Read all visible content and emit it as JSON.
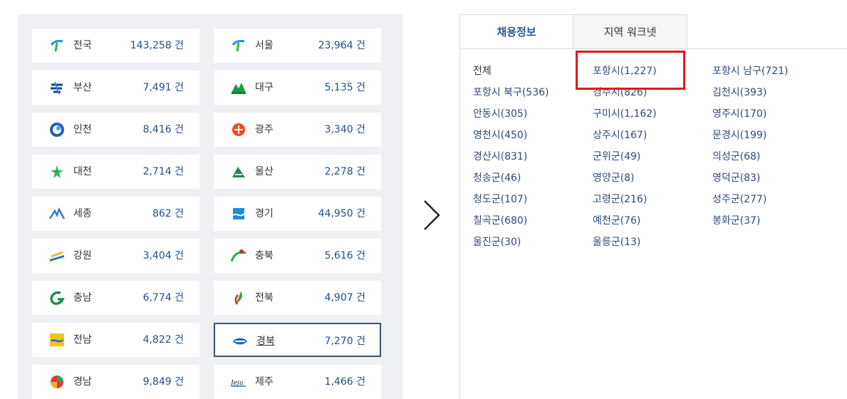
{
  "regions": [
    {
      "name": "전국",
      "count": "143,258 건",
      "icon": "nationwide-logo"
    },
    {
      "name": "서울",
      "count": "23,964 건",
      "icon": "seoul-logo"
    },
    {
      "name": "부산",
      "count": "7,491 건",
      "icon": "busan-logo"
    },
    {
      "name": "대구",
      "count": "5,135 건",
      "icon": "daegu-logo"
    },
    {
      "name": "인천",
      "count": "8,416 건",
      "icon": "incheon-logo"
    },
    {
      "name": "광주",
      "count": "3,340 건",
      "icon": "gwangju-logo"
    },
    {
      "name": "대전",
      "count": "2,714 건",
      "icon": "daejeon-logo"
    },
    {
      "name": "울산",
      "count": "2,278 건",
      "icon": "ulsan-logo"
    },
    {
      "name": "세종",
      "count": "862 건",
      "icon": "sejong-logo"
    },
    {
      "name": "경기",
      "count": "44,950 건",
      "icon": "gyeonggi-logo"
    },
    {
      "name": "강원",
      "count": "3,404 건",
      "icon": "gangwon-logo"
    },
    {
      "name": "충북",
      "count": "5,616 건",
      "icon": "chungbuk-logo"
    },
    {
      "name": "충남",
      "count": "6,774 건",
      "icon": "chungnam-logo"
    },
    {
      "name": "전북",
      "count": "4,907 건",
      "icon": "jeonbuk-logo"
    },
    {
      "name": "전남",
      "count": "4,822 건",
      "icon": "jeonnam-logo"
    },
    {
      "name": "경북",
      "count": "7,270 건",
      "icon": "gyeongbuk-logo",
      "selected": true
    },
    {
      "name": "경남",
      "count": "9,849 건",
      "icon": "gyeongnam-logo"
    },
    {
      "name": "제주",
      "count": "1,466 건",
      "icon": "jeju-logo"
    }
  ],
  "tabs": [
    {
      "label": "채용정보",
      "active": true
    },
    {
      "label": "지역 워크넷",
      "active": false
    }
  ],
  "cities": [
    "전체",
    "포항시(1,227)",
    "포항시 남구(721)",
    "포항시 북구(536)",
    "경주시(826)",
    "김천시(393)",
    "안동시(305)",
    "구미시(1,162)",
    "영주시(170)",
    "영천시(450)",
    "상주시(167)",
    "문경시(199)",
    "경산시(831)",
    "군위군(49)",
    "의성군(68)",
    "청송군(46)",
    "영양군(8)",
    "영덕군(83)",
    "청도군(107)",
    "고령군(216)",
    "성주군(277)",
    "칠곡군(680)",
    "예천군(76)",
    "봉화군(37)",
    "울진군(30)",
    "울릉군(13)"
  ],
  "colors": {
    "accent": "#2d5597",
    "highlight": "#e4161b",
    "selected_border": "#3b5275",
    "panel_bg": "#eef0f4"
  }
}
